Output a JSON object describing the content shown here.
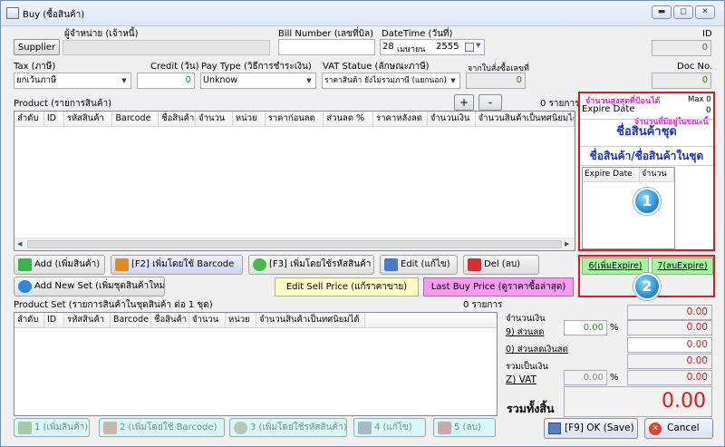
{
  "window": {
    "title": "Buy (ซื้อสินค้า)"
  },
  "header": {
    "supplier_btn": "Supplier",
    "supplier_label": "ผู้จำหน่าย (เจ้าหนี้)",
    "bill_label": "Bill Number (เลขที่บิล)",
    "datetime_label": "DateTime (วันที่)",
    "date_day": "28",
    "date_month": "เมษายน",
    "date_year": "2555",
    "id_label": "ID",
    "id_value": "0",
    "tax_label": "Tax (ภาษี)",
    "tax_value": "ยกเว้นภาษี",
    "credit_label": "Credit (วัน)",
    "credit_value": "0",
    "paytype_label": "Pay Type (วิธีการชำระเงิน)",
    "paytype_value": "Unknow",
    "vat_label": "VAT Statue (ลักษณะภาษี)",
    "vat_value": "ราคาสินค้า ยังไม่รวมภาษี (แยกนอก)",
    "from_order_label": "จากใบสั่งซื้อเลขที่",
    "from_order_value": "0",
    "docno_label": "Doc No.",
    "docno_value": "0"
  },
  "product": {
    "title": "Product (รายการสินค้า)",
    "plus": "+",
    "minus": "-",
    "count": "0 รายการ",
    "columns": [
      "ลำดับ",
      "ID",
      "รหัสสินค้า",
      "Barcode",
      "ชื่อสินค้า",
      "จำนวน",
      "หน่วย",
      "ราคาก่อนลด",
      "ส่วนลด %",
      "ราคาหลังลด",
      "จำนวนเงิน",
      "จำนวนสินค้าเป็นทศนิยมได้"
    ]
  },
  "side": {
    "max_label": "จำนวนสูงสุดที่ป้อนได้",
    "max_value": "Max 0",
    "expire_label": "Expire Date",
    "expire_value": "0",
    "current_label": "จำนวนที่มีอยู่ในขณะนี้",
    "set_name": "ชื่อสินค้าชุด",
    "set_product_name": "ชื่อสินค้า/ชื่อสินค้าในชุด",
    "col_expire": "Expire Date",
    "col_qty": "จำนวน",
    "badge1": "1",
    "badge2": "2",
    "add_expire": "6(เพิ่มExpire)",
    "del_expire": "7(ลบExpire)"
  },
  "actions": {
    "add": "Add (เพิ่มสินค้า)",
    "f2": "[F2] เพิ่มโดยใช้ Barcode",
    "f3": "[F3] เพิ่มโดยใช้รหัสสินค้า",
    "edit": "Edit (แก้ไข)",
    "del": "Del (ลบ)",
    "add_new_set": "Add New Set (เพิ่มชุดสินค้าใหม่)",
    "edit_sell": "Edit Sell Price (แก้ราคาขาย)",
    "last_buy": "Last Buy Price (ดูราคาซื้อล่าสุด)"
  },
  "product_set": {
    "title": "Product Set (รายการสินค้าในชุดสินค้า ต่อ 1 ชุด)",
    "count": "0 รายการ",
    "columns": [
      "ลำดับ",
      "ID",
      "รหัสสินค้า",
      "Barcode",
      "ชื่อสินค้า",
      "จำนวน",
      "หน่วย",
      "จำนวนสินค้าเป็นทศนิยมได้"
    ]
  },
  "bottom": {
    "b1": "1 (เพิ่มสินค้า)",
    "b2": "2 (เพิ่มโดยใช้ Barcode)",
    "b3": "3 (เพิ่มโดยใช้รหัสสินค้า)",
    "b4": "4 (แก้ไข)",
    "b5": "5 (ลบ)",
    "ok": "[F9] OK (Save)",
    "cancel": "Cancel"
  },
  "summary": {
    "amount_label": "จำนวนเงิน",
    "amount": "0.00",
    "discount_label": "9) ส่วนลด",
    "discount_pct": "0.00",
    "pct": "%",
    "discount": "0.00",
    "cash_discount_label": "0) ส่วนลดเงินสด",
    "cash_discount": "0.00",
    "total_label": "รวมเป็นเงิน",
    "total": "0.00",
    "vat_label": "Z) VAT",
    "vat_pct": "0.00",
    "vat": "0.00",
    "grand_label": "รวมทั้งสิ้น",
    "grand": "0.00"
  },
  "colors": {
    "accent_red": "#e8151b",
    "blue_text": "#1a33c8",
    "magenta": "#e020c8"
  }
}
